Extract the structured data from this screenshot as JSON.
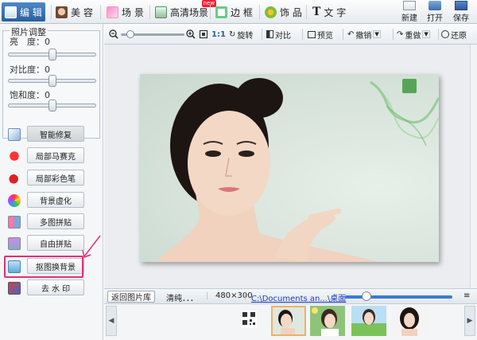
{
  "top_tabs": [
    {
      "label": "编 辑",
      "icon": "image-icon",
      "active": true
    },
    {
      "label": "美 容",
      "icon": "face-icon"
    },
    {
      "label": "场 景",
      "icon": "scene-icon"
    },
    {
      "label": "高清场景",
      "icon": "hd-scene-icon",
      "badge": "new"
    },
    {
      "label": "边 框",
      "icon": "frame-icon"
    },
    {
      "label": "饰 品",
      "icon": "clover-icon"
    },
    {
      "label": "文 字",
      "icon": "text-icon",
      "glyph": "T"
    }
  ],
  "file_buttons": [
    {
      "label": "新建",
      "icon": "new-icon"
    },
    {
      "label": "打开",
      "icon": "folder-icon"
    },
    {
      "label": "保存",
      "icon": "save-icon"
    }
  ],
  "adjust": {
    "title": "照片调整",
    "brightness_label": "亮　度：",
    "brightness_value": "0",
    "contrast_label": "对比度：",
    "contrast_value": "0",
    "saturation_label": "饱和度：",
    "saturation_value": "0",
    "slider_level": 0.5
  },
  "tools": [
    {
      "label": "智能修复",
      "icon": "magic-wand-icon",
      "selected": true
    },
    {
      "label": "局部马赛克",
      "icon": "mosaic-icon"
    },
    {
      "label": "局部彩色笔",
      "icon": "color-pen-icon"
    },
    {
      "label": "背景虚化",
      "icon": "blur-icon"
    },
    {
      "label": "多图拼贴",
      "icon": "collage-icon"
    },
    {
      "label": "自由拼贴",
      "icon": "free-collage-icon"
    },
    {
      "label": "抠图换背景",
      "icon": "cutout-icon",
      "highlighted": true
    },
    {
      "label": "去 水 印",
      "icon": "watermark-icon"
    }
  ],
  "edit_toolbar": {
    "zoom_level": 0.15,
    "fit_label": "1:1",
    "rotate": "旋转",
    "contrast": "对比",
    "preview": "预览",
    "undo": "撤销",
    "redo": "重做",
    "restore": "还原"
  },
  "bottom": {
    "back": "返回图片库",
    "filename": "清纯．．．",
    "size": "480×300",
    "path": "C:\\Documents an...\\桌面",
    "thumb_size_level": 0.2
  },
  "colors": {
    "tab_active": "#3b73b8",
    "highlight": "#e0307a",
    "accent_blue": "#3a7bd5"
  }
}
